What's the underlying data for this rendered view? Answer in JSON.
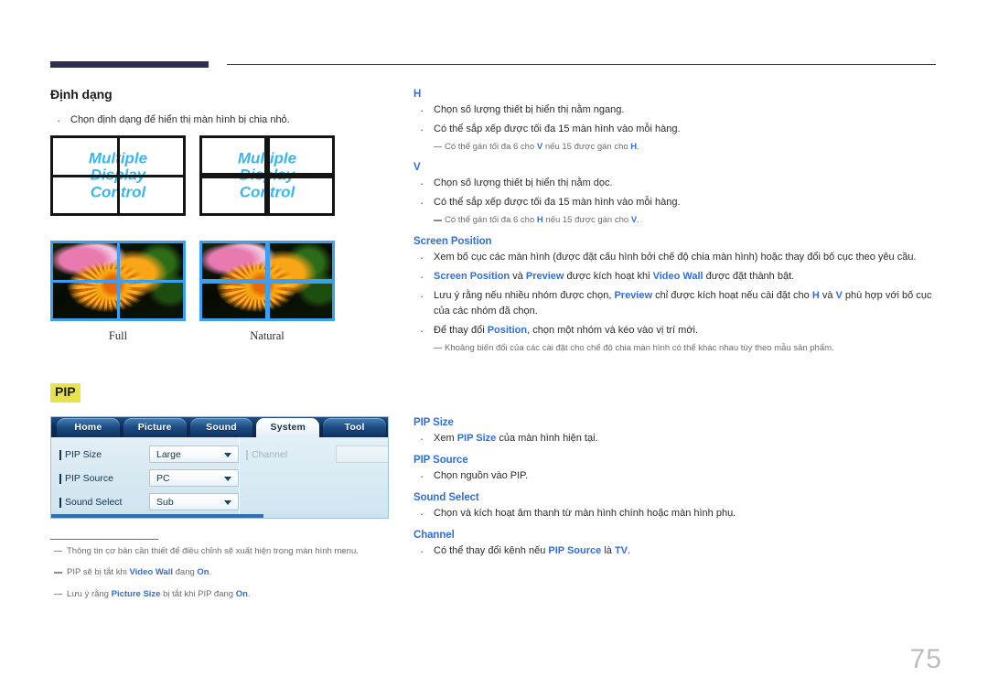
{
  "page": {
    "number": "75"
  },
  "left": {
    "section_title": "Định dạng",
    "bullet": "Chọn định dạng để hiển thị màn hình bị chia nhỏ.",
    "diagram": {
      "wall_text_lines": [
        "Multiple",
        "Display",
        "Control"
      ],
      "captions": [
        "Full",
        "Natural"
      ]
    },
    "pip_badge": "PIP",
    "osd": {
      "tabs": [
        "Home",
        "Picture",
        "Sound",
        "System",
        "Tool"
      ],
      "active_tab": "System",
      "rows": [
        {
          "label": "PIP Size",
          "value": "Large"
        },
        {
          "label": "PIP Source",
          "value": "PC"
        },
        {
          "label": "Sound Select",
          "value": "Sub"
        }
      ],
      "right_row": {
        "label": "Channel",
        "value": ""
      }
    },
    "footnotes": [
      "Thông tin cơ bản cần thiết để điều chỉnh sẽ xuất hiện trong màn hình menu.",
      "PIP sẽ bị tắt khi Video Wall đang On.",
      "Lưu ý rằng Picture Size bị tắt khi PIP đang On."
    ],
    "footnote_parts": [
      {
        "pre": "Thông tin cơ bản cần thiết để điều chỉnh sẽ xuất hiện trong màn hình menu.",
        "b1": "",
        "mid": "",
        "b2": "",
        "post": ""
      },
      {
        "pre": "PIP sẽ bị tắt khi ",
        "b1": "Video Wall",
        "mid": " đang ",
        "b2": "On",
        "post": "."
      },
      {
        "pre": "Lưu ý rằng ",
        "b1": "Picture Size",
        "mid": " bị tắt khi PIP đang ",
        "b2": "On",
        "post": "."
      }
    ]
  },
  "right": {
    "h_section": {
      "heading": "H",
      "bullets": [
        "Chọn số lượng thiết bị hiển thị nằm ngang.",
        "Có thể sắp xếp được tối đa 15 màn hình vào mỗi hàng."
      ],
      "note_pre": "Có thể gán tối đa 6 cho ",
      "note_b1": "V",
      "note_mid": " nếu 15 được gán cho ",
      "note_b2": "H",
      "note_post": "."
    },
    "v_section": {
      "heading": "V",
      "bullets": [
        "Chọn số lượng thiết bị hiển thị nằm dọc.",
        "Có thể sắp xếp được tối đa 15 màn hình vào mỗi hàng."
      ],
      "note_pre": "Có thể gán tối đa 6 cho ",
      "note_b1": "H",
      "note_mid": " nếu 15 được gán cho ",
      "note_b2": "V",
      "note_post": "."
    },
    "screen_position": {
      "heading": "Screen Position",
      "b1_text": "Xem bố cục các màn hình (được đặt cấu hình bởi chế độ chia màn hình) hoặc thay đổi bố cục theo yêu cầu.",
      "b2_a": "Screen Position",
      "b2_b": " và ",
      "b2_c": "Preview",
      "b2_d": " được kích hoạt khi ",
      "b2_e": "Video Wall",
      "b2_f": " được đặt thành bật.",
      "b3_a": "Lưu ý rằng nếu nhiều nhóm được chọn, ",
      "b3_b": "Preview",
      "b3_c": " chỉ được kích hoạt nếu cài đặt cho ",
      "b3_d": "H",
      "b3_e": " và ",
      "b3_f": "V",
      "b3_g": " phù hợp với bố cục của các nhóm đã chọn.",
      "b4_a": "Để thay đổi ",
      "b4_b": "Position",
      "b4_c": ", chọn một nhóm và kéo vào vị trí mới.",
      "note": "Khoảng biến đổi của các cài đặt cho chế độ chia màn hình có thể khác nhau tùy theo mẫu sản phẩm."
    },
    "pip_size": {
      "heading": "PIP Size",
      "b_pre": "Xem ",
      "b_blue": "PIP Size",
      "b_post": " của màn hình hiện tại."
    },
    "pip_source": {
      "heading": "PIP Source",
      "bullet": "Chọn nguồn vào PIP."
    },
    "sound_select": {
      "heading": "Sound Select",
      "bullet": "Chọn và kích hoạt âm thanh từ màn hình chính hoặc màn hình phụ."
    },
    "channel": {
      "heading": "Channel",
      "b_pre": "Có thể thay đổi kênh nếu ",
      "b_blue1": "PIP Source",
      "b_mid": " là ",
      "b_blue2": "TV",
      "b_post": "."
    }
  },
  "colors": {
    "blue": "#2e6ee0",
    "header_bar": "#2e3050",
    "highlight": "#e8e34c",
    "wall_text": "#37b6ef",
    "page_number": "#bdbdbd"
  }
}
